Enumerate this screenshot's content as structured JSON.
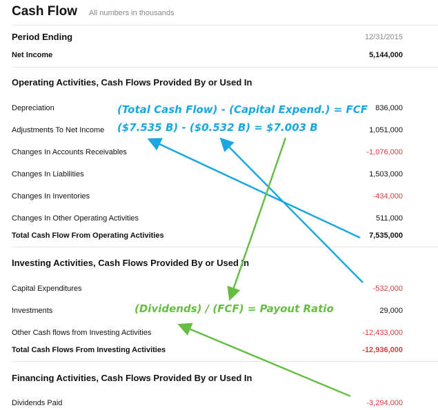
{
  "header": {
    "title": "Cash Flow",
    "subtitle": "All numbers in thousands"
  },
  "period": {
    "label": "Period Ending",
    "value": "12/31/2015"
  },
  "net_income": {
    "label": "Net Income",
    "value": "5,144,000"
  },
  "operating": {
    "heading": "Operating Activities, Cash Flows Provided By or Used In",
    "rows": [
      {
        "label": "Depreciation",
        "value": "836,000"
      },
      {
        "label": "Adjustments To Net Income",
        "value": "1,051,000"
      },
      {
        "label": "Changes In Accounts Receivables",
        "value": "-1,076,000"
      },
      {
        "label": "Changes In Liabilities",
        "value": "1,503,000"
      },
      {
        "label": "Changes In Inventories",
        "value": "-434,000"
      },
      {
        "label": "Changes In Other Operating Activities",
        "value": "511,000"
      }
    ],
    "total": {
      "label": "Total Cash Flow From Operating Activities",
      "value": "7,535,000"
    }
  },
  "investing": {
    "heading": "Investing Activities, Cash Flows Provided By or Used In",
    "rows": [
      {
        "label": "Capital Expenditures",
        "value": "-532,000"
      },
      {
        "label": "Investments",
        "value": "29,000"
      },
      {
        "label": "Other Cash flows from Investing Activities",
        "value": "-12,433,000"
      }
    ],
    "total": {
      "label": "Total Cash Flows From Investing Activities",
      "value": "-12,936,000"
    }
  },
  "financing": {
    "heading": "Financing Activities, Cash Flows Provided By or Used In",
    "rows": [
      {
        "label": "Dividends Paid",
        "value": "-3,294,000"
      }
    ]
  },
  "annotations": {
    "fcf_formula": "(Total Cash Flow) - (Capital Expend.) = FCF",
    "fcf_calc": "($7.535 B) - ($0.532 B) = $7.003 B",
    "payout_formula": "(Dividends) / (FCF) = Payout Ratio"
  },
  "colors": {
    "negative": "#e23a3a",
    "annotation_blue": "#1aa6de",
    "annotation_green": "#66bd44"
  }
}
